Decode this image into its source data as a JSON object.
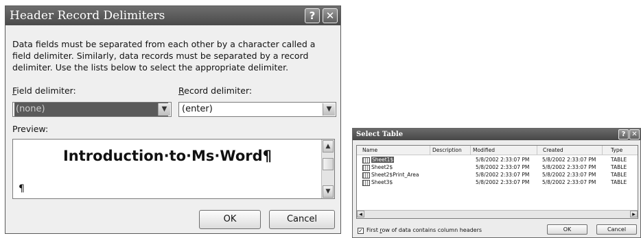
{
  "dialog1": {
    "title": "Header Record Delimiters",
    "help_label": "?",
    "close_label": "✕",
    "description": "Data fields must be separated from each other by a character called a field delimiter. Similarly, data records must be separated by a record delimiter.  Use the lists below to select the appropriate delimiter.",
    "field_label_key": "F",
    "field_label_rest": "ield delimiter:",
    "field_value": "(none)",
    "record_label_key": "R",
    "record_label_rest": "ecord delimiter:",
    "record_value": "(enter)",
    "preview_label": "Preview:",
    "preview_text": "Introduction·to·Ms·Word¶",
    "preview_para": "¶",
    "ok_label": "OK",
    "cancel_label": "Cancel"
  },
  "dialog2": {
    "title": "Select Table",
    "help_label": "?",
    "close_label": "✕",
    "columns": [
      "Name",
      "Description",
      "Modified",
      "Created",
      "Type"
    ],
    "rows": [
      {
        "name": "Sheet1$",
        "description": "",
        "modified": "5/8/2002 2:33:07 PM",
        "created": "5/8/2002 2:33:07 PM",
        "type": "TABLE"
      },
      {
        "name": "Sheet2$",
        "description": "",
        "modified": "5/8/2002 2:33:07 PM",
        "created": "5/8/2002 2:33:07 PM",
        "type": "TABLE"
      },
      {
        "name": "Sheet2$Print_Area",
        "description": "",
        "modified": "5/8/2002 2:33:07 PM",
        "created": "5/8/2002 2:33:07 PM",
        "type": "TABLE"
      },
      {
        "name": "Sheet3$",
        "description": "",
        "modified": "5/8/2002 2:33:07 PM",
        "created": "5/8/2002 2:33:07 PM",
        "type": "TABLE"
      }
    ],
    "checkbox_pre": "First ",
    "checkbox_key": "r",
    "checkbox_rest": "ow of data contains column headers",
    "ok_label": "OK",
    "cancel_label": "Cancel"
  }
}
